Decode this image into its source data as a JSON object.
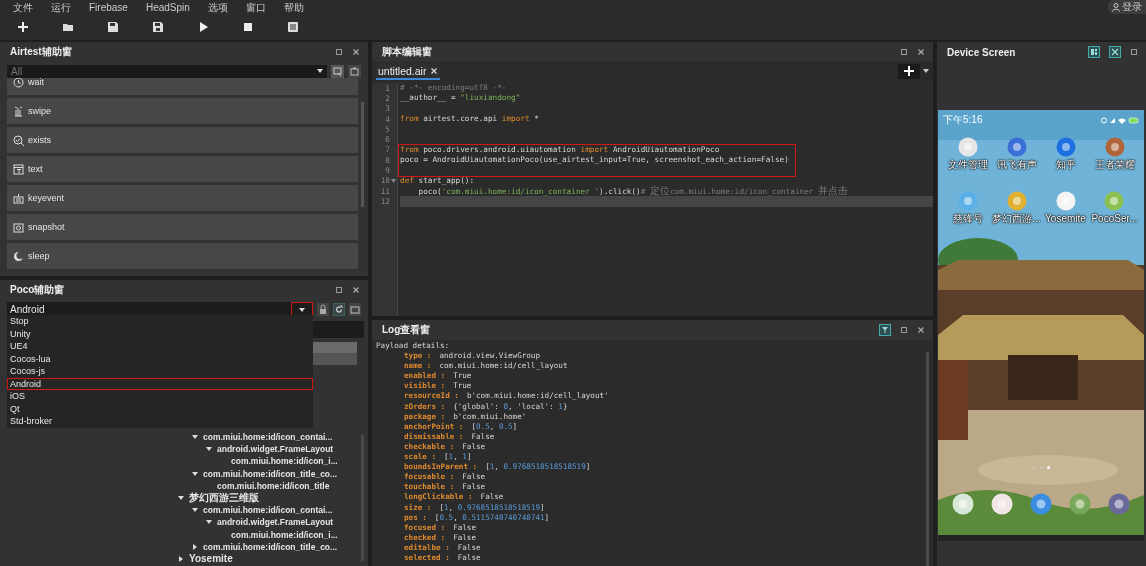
{
  "menu": [
    {
      "label": "文件"
    },
    {
      "label": "运行"
    },
    {
      "label": "Firebase"
    },
    {
      "label": "HeadSpin"
    },
    {
      "label": "选项"
    },
    {
      "label": "窗口"
    },
    {
      "label": "帮助"
    }
  ],
  "account": {
    "label": "登录"
  },
  "airtest_panel": {
    "title": "Airtest辅助窗",
    "filter": {
      "placeholder": "All"
    },
    "items": [
      {
        "kind": "wait",
        "label": "wait"
      },
      {
        "kind": "swipe",
        "label": "swipe"
      },
      {
        "kind": "exists",
        "label": "exists"
      },
      {
        "kind": "text",
        "label": "text"
      },
      {
        "kind": "keyevent",
        "label": "keyevent"
      },
      {
        "kind": "snapshot",
        "label": "snapshot"
      },
      {
        "kind": "sleep",
        "label": "sleep"
      }
    ]
  },
  "poco_panel": {
    "title": "Poco辅助窗",
    "mode": {
      "value": "Android",
      "arrow_highlighted": true
    },
    "options": [
      {
        "label": "Stop",
        "highlighted": false
      },
      {
        "label": "Unity",
        "highlighted": false
      },
      {
        "label": "UE4",
        "highlighted": false
      },
      {
        "label": "Cocos-lua",
        "highlighted": false
      },
      {
        "label": "Cocos-js",
        "highlighted": false
      },
      {
        "label": "Android",
        "highlighted": true
      },
      {
        "label": "iOS",
        "highlighted": false
      },
      {
        "label": "Qt",
        "highlighted": false
      },
      {
        "label": "Std-broker",
        "highlighted": false
      }
    ],
    "tree": [
      {
        "children": [
          {
            "label": "com.miui.home:id/icon_contai...",
            "expanded": true,
            "children": [
              {
                "label": "android.widget.FrameLayout",
                "expanded": true,
                "children": [
                  {
                    "label": "com.miui.home:id/icon_i..."
                  }
                ]
              }
            ]
          },
          {
            "label": "com.miui.home:id/icon_title_co...",
            "expanded": true,
            "children": [
              {
                "label": "com.miui.home:id/icon_title"
              }
            ]
          }
        ]
      },
      {
        "label": "梦幻西游三维版",
        "expanded": true,
        "children": [
          {
            "label": "com.miui.home:id/icon_contai...",
            "expanded": true,
            "children": [
              {
                "label": "android.widget.FrameLayout",
                "expanded": true,
                "children": [
                  {
                    "label": "com.miui.home:id/icon_i..."
                  }
                ]
              }
            ]
          },
          {
            "label": "com.miui.home:id/icon_title_co...",
            "expanded": false
          }
        ]
      },
      {
        "label": "Yosemite",
        "expanded": false
      }
    ]
  },
  "editor": {
    "title": "脚本编辑窗",
    "tabs": [
      {
        "label": "untitled.air",
        "selected": true
      }
    ],
    "lines": [
      {
        "number": "1",
        "highlighted": false,
        "current": false,
        "tokens": [
          {
            "kind": "comment",
            "text": "# -*- encoding=utf8 -*-"
          }
        ]
      },
      {
        "number": "2",
        "highlighted": false,
        "current": false,
        "tokens": [
          {
            "kind": "plain",
            "text": "__author__ = "
          },
          {
            "kind": "str",
            "text": "\"liuxiandong\""
          }
        ]
      },
      {
        "number": "3",
        "highlighted": false,
        "current": false
      },
      {
        "number": "4",
        "highlighted": false,
        "current": false,
        "tokens": [
          {
            "kind": "kw",
            "text": "from"
          },
          {
            "kind": "plain",
            "text": " airtest.core.api "
          },
          {
            "kind": "kw",
            "text": "import"
          },
          {
            "kind": "plain",
            "text": " *"
          }
        ]
      },
      {
        "number": "5",
        "highlighted": false,
        "current": false
      },
      {
        "number": "6",
        "highlighted": false,
        "current": false
      },
      {
        "number": "7",
        "highlighted": true,
        "current": false,
        "tokens": [
          {
            "kind": "kw",
            "text": "from"
          },
          {
            "kind": "plain",
            "text": " poco.drivers.android.uiautomation "
          },
          {
            "kind": "kw",
            "text": "import"
          },
          {
            "kind": "plain",
            "text": " AndroidUiautomationPoco"
          }
        ]
      },
      {
        "number": "8",
        "highlighted": true,
        "current": false,
        "tokens": [
          {
            "kind": "plain",
            "text": "poco = AndroidUiautomationPoco(use_airtest_input=True, screenshot_each_action=False)"
          }
        ]
      },
      {
        "number": "9",
        "highlighted": true,
        "current": false
      },
      {
        "number": "10",
        "highlighted": false,
        "current": false,
        "fold": true,
        "tokens": [
          {
            "kind": "kw",
            "text": "def"
          },
          {
            "kind": "plain",
            "text": " start_app():"
          }
        ]
      },
      {
        "number": "11",
        "highlighted": false,
        "current": false,
        "tokens": [
          {
            "kind": "plain",
            "text": "    poco("
          },
          {
            "kind": "str",
            "text": "'com.miui.home:id/icon_container '"
          },
          {
            "kind": "plain",
            "text": ").click()"
          },
          {
            "kind": "comment",
            "text": "# "
          },
          {
            "kind": "note",
            "text": "定位"
          },
          {
            "kind": "comment",
            "text": "com.miui.home:id/icon_container "
          },
          {
            "kind": "note",
            "text": "并点击"
          }
        ]
      },
      {
        "number": "12",
        "highlighted": false,
        "current": true
      }
    ]
  },
  "log": {
    "title": "Log查看窗",
    "lines": [
      {
        "text": "Payload details:"
      },
      {
        "key": "type :",
        "value": [
          {
            "kind": "plain",
            "text": "android.view.ViewGroup"
          }
        ]
      },
      {
        "key": "name :",
        "value": [
          {
            "kind": "plain",
            "text": "com.miui.home:id/cell_layout"
          }
        ]
      },
      {
        "key": "enabled :",
        "value": [
          {
            "kind": "plain",
            "text": "True"
          }
        ]
      },
      {
        "key": "visible :",
        "value": [
          {
            "kind": "plain",
            "text": "True"
          }
        ]
      },
      {
        "key": "resourceId :",
        "value": [
          {
            "kind": "plain",
            "text": "b'com.miui.home:id/cell_layout'"
          }
        ]
      },
      {
        "key": "zOrders :",
        "value": [
          {
            "kind": "plain",
            "text": "{'global': "
          },
          {
            "kind": "num",
            "text": "0"
          },
          {
            "kind": "plain",
            "text": ", 'local': "
          },
          {
            "kind": "num",
            "text": "1"
          },
          {
            "kind": "plain",
            "text": "}"
          }
        ]
      },
      {
        "key": "package :",
        "value": [
          {
            "kind": "plain",
            "text": "b'com.miui.home'"
          }
        ]
      },
      {
        "key": "anchorPoint :",
        "value": [
          {
            "kind": "plain",
            "text": "["
          },
          {
            "kind": "num",
            "text": "0.5"
          },
          {
            "kind": "plain",
            "text": ", "
          },
          {
            "kind": "num",
            "text": "0.5"
          },
          {
            "kind": "plain",
            "text": "]"
          }
        ]
      },
      {
        "key": "dismissable :",
        "value": [
          {
            "kind": "plain",
            "text": "False"
          }
        ]
      },
      {
        "key": "checkable :",
        "value": [
          {
            "kind": "plain",
            "text": "False"
          }
        ]
      },
      {
        "key": "scale :",
        "value": [
          {
            "kind": "plain",
            "text": "["
          },
          {
            "kind": "num",
            "text": "1"
          },
          {
            "kind": "plain",
            "text": ", "
          },
          {
            "kind": "num",
            "text": "1"
          },
          {
            "kind": "plain",
            "text": "]"
          }
        ]
      },
      {
        "key": "boundsInParent :",
        "value": [
          {
            "kind": "plain",
            "text": "["
          },
          {
            "kind": "num",
            "text": "1"
          },
          {
            "kind": "plain",
            "text": ", "
          },
          {
            "kind": "num",
            "text": "0.9768518518518519"
          },
          {
            "kind": "plain",
            "text": "]"
          }
        ]
      },
      {
        "key": "focusable :",
        "value": [
          {
            "kind": "plain",
            "text": "False"
          }
        ]
      },
      {
        "key": "touchable :",
        "value": [
          {
            "kind": "plain",
            "text": "False"
          }
        ]
      },
      {
        "key": "longClickable :",
        "value": [
          {
            "kind": "plain",
            "text": "False"
          }
        ]
      },
      {
        "key": "size :",
        "value": [
          {
            "kind": "plain",
            "text": "["
          },
          {
            "kind": "num",
            "text": "1"
          },
          {
            "kind": "plain",
            "text": ", "
          },
          {
            "kind": "num",
            "text": "0.9768518518518519"
          },
          {
            "kind": "plain",
            "text": "]"
          }
        ]
      },
      {
        "key": "pos :",
        "value": [
          {
            "kind": "plain",
            "text": "["
          },
          {
            "kind": "num",
            "text": "0.5"
          },
          {
            "kind": "plain",
            "text": ", "
          },
          {
            "kind": "num",
            "text": "0.5115740740740741"
          },
          {
            "kind": "plain",
            "text": "]"
          }
        ]
      },
      {
        "key": "focused :",
        "value": [
          {
            "kind": "plain",
            "text": "False"
          }
        ]
      },
      {
        "key": "checked :",
        "value": [
          {
            "kind": "plain",
            "text": "False"
          }
        ]
      },
      {
        "key": "editalbe :",
        "value": [
          {
            "kind": "plain",
            "text": "False"
          }
        ]
      },
      {
        "key": "selected :",
        "value": [
          {
            "kind": "plain",
            "text": "False"
          }
        ]
      }
    ]
  },
  "device": {
    "title": "Device Screen",
    "phone": {
      "time": "下午5:16",
      "apps": [
        {
          "label": "文件管理",
          "color": "#e6e6e6"
        },
        {
          "label": "讯飞有声",
          "color": "#3a6fd8"
        },
        {
          "label": "知乎",
          "color": "#1e6fe0"
        },
        {
          "label": "王者荣耀",
          "color": "#b0643a"
        },
        {
          "label": "慈锋号",
          "color": "#5bb0e8"
        },
        {
          "label": "梦幻西游...",
          "color": "#e0b030"
        },
        {
          "label": "Yosemite",
          "color": "#f4f4f4"
        },
        {
          "label": "PocoSer...",
          "color": "#8cc152"
        }
      ],
      "pages": [
        {
          "selected": false
        },
        {
          "selected": false
        },
        {
          "selected": true
        }
      ],
      "dock": [
        {
          "color": "#d8e8d8"
        },
        {
          "color": "#f0e6e6"
        },
        {
          "color": "#3b8de0"
        },
        {
          "color": "#7aa85a"
        },
        {
          "color": "#6a6a9a"
        }
      ]
    }
  }
}
